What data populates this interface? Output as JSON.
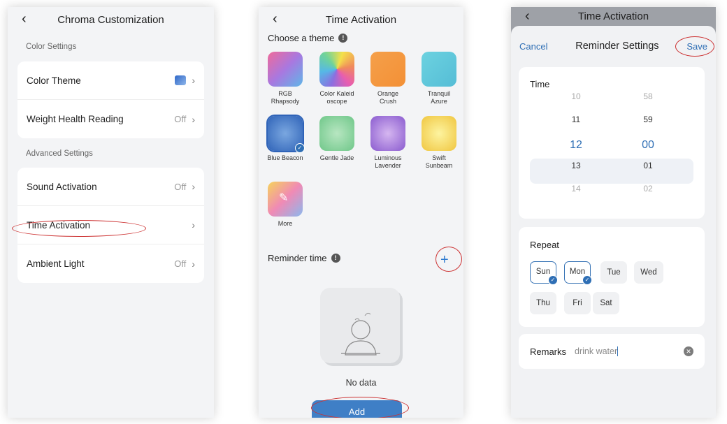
{
  "screen1": {
    "title": "Chroma Customization",
    "color_settings_header": "Color Settings",
    "color_theme_label": "Color Theme",
    "weight_label": "Weight Health Reading",
    "weight_value": "Off",
    "advanced_header": "Advanced Settings",
    "sound_label": "Sound Activation",
    "sound_value": "Off",
    "time_label": "Time Activation",
    "ambient_label": "Ambient Light",
    "ambient_value": "Off"
  },
  "screen2": {
    "title": "Time Activation",
    "choose_theme": "Choose a theme",
    "themes": [
      {
        "name": "RGB\nRhapsody",
        "gradient": "linear-gradient(135deg,#f06a9a,#a878e0,#5fb6e8)"
      },
      {
        "name": "Color Kaleid\noscope",
        "gradient": "conic-gradient(from 20deg,#f4e04a,#f08a5c,#e85db0,#8b6fe0,#56b8e6,#6fd39a,#f4e04a)"
      },
      {
        "name": "Orange\nCrush",
        "gradient": "linear-gradient(135deg,#f5a04a,#f39036)"
      },
      {
        "name": "Tranquil\nAzure",
        "gradient": "linear-gradient(135deg,#6cd2e0,#55bdd6)"
      },
      {
        "name": "Blue Beacon",
        "gradient": "radial-gradient(circle,#7aa7e0,#2f63b8)"
      },
      {
        "name": "Gentle Jade",
        "gradient": "radial-gradient(circle,#b7e6c1,#6fc789)"
      },
      {
        "name": "Luminous\nLavender",
        "gradient": "radial-gradient(circle,#d5b6f0,#8a5bcf)"
      },
      {
        "name": "Swift\nSunbeam",
        "gradient": "radial-gradient(circle,#fdf4a0,#f0c640)"
      },
      {
        "name": "More",
        "gradient": "linear-gradient(135deg,#f6d35a,#f08ab5,#8bb8ee)"
      }
    ],
    "reminder_title": "Reminder time",
    "no_data": "No data",
    "add_label": "Add"
  },
  "screen3": {
    "under_title": "Time Activation",
    "cancel": "Cancel",
    "title": "Reminder Settings",
    "save": "Save",
    "time_label": "Time",
    "hours": [
      "10",
      "11",
      "12",
      "13",
      "14"
    ],
    "minutes": [
      "58",
      "59",
      "00",
      "01",
      "02"
    ],
    "repeat_label": "Repeat",
    "days": [
      {
        "label": "Sun",
        "selected": true
      },
      {
        "label": "Mon",
        "selected": true
      },
      {
        "label": "Tue",
        "selected": false
      },
      {
        "label": "Wed",
        "selected": false
      },
      {
        "label": "Thu",
        "selected": false
      },
      {
        "label": "Fri",
        "selected": false
      },
      {
        "label": "Sat",
        "selected": false
      }
    ],
    "remarks_label": "Remarks",
    "remarks_value": "drink water"
  },
  "colors": {
    "accent": "#2f6fb5",
    "highlight": "#cc3030"
  }
}
